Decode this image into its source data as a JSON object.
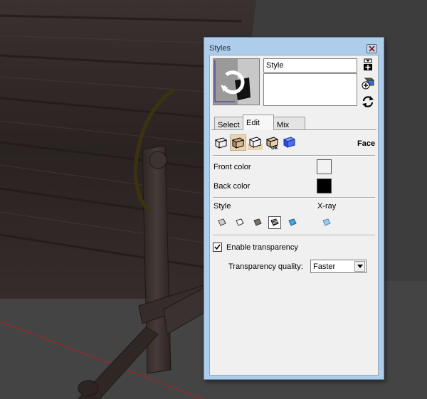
{
  "window": {
    "title": "Styles"
  },
  "style": {
    "name": "Style",
    "description": ""
  },
  "tabs": [
    {
      "label": "Select",
      "active": false
    },
    {
      "label": "Edit",
      "active": true
    },
    {
      "label": "Mix",
      "active": false
    }
  ],
  "edit_toolbar": {
    "section_label": "Face",
    "buttons": [
      {
        "icon": "edge-settings-icon",
        "active": false
      },
      {
        "icon": "face-settings-icon",
        "active": true
      },
      {
        "icon": "background-settings-icon",
        "active": false
      },
      {
        "icon": "watermark-settings-icon",
        "active": false
      },
      {
        "icon": "modeling-settings-icon",
        "active": false
      }
    ]
  },
  "face": {
    "front_color_label": "Front color",
    "front_color": "#f2f2f2",
    "back_color_label": "Back color",
    "back_color": "#000000",
    "style_label": "Style",
    "xray_label": "X-ray",
    "style_buttons": [
      {
        "icon": "wireframe-icon",
        "active": false
      },
      {
        "icon": "hidden-line-icon",
        "active": false
      },
      {
        "icon": "shaded-icon",
        "active": false
      },
      {
        "icon": "shaded-with-textures-icon",
        "active": true
      },
      {
        "icon": "shaded-using-all-same-icon",
        "active": false
      }
    ],
    "enable_transparency_label": "Enable transparency",
    "enable_transparency": true,
    "transparency_quality_label": "Transparency quality:",
    "transparency_quality": "Faster"
  },
  "colors": {
    "window_frame": "#aecdea",
    "active_button": "#e8d3b3"
  }
}
